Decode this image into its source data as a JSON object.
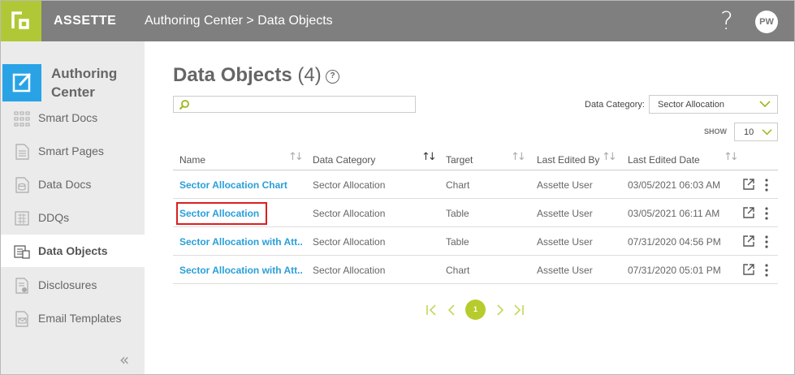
{
  "header": {
    "brand": "ASSETTE",
    "breadcrumb": "Authoring Center > Data Objects",
    "help": "?",
    "avatar": "PW"
  },
  "sidebar": {
    "title": "Authoring Center",
    "items": [
      {
        "label": "Smart Docs",
        "icon": "grid-dots-icon"
      },
      {
        "label": "Smart Pages",
        "icon": "page-icon"
      },
      {
        "label": "Data Docs",
        "icon": "data-doc-icon"
      },
      {
        "label": "DDQs",
        "icon": "ddq-icon"
      },
      {
        "label": "Data Objects",
        "icon": "data-objects-icon",
        "active": true
      },
      {
        "label": "Disclosures",
        "icon": "disclosure-icon"
      },
      {
        "label": "Email Templates",
        "icon": "email-template-icon"
      }
    ],
    "collapse": "«"
  },
  "main": {
    "title": "Data Objects",
    "count": "(4)",
    "title_help": "?",
    "search_placeholder": "",
    "category_label": "Data Category:",
    "category_value": "Sector Allocation",
    "show_label": "SHOW",
    "show_value": "10"
  },
  "table": {
    "columns": [
      "Name",
      "Data Category",
      "Target",
      "Last Edited By",
      "Last Edited Date"
    ],
    "rows": [
      {
        "name": "Sector Allocation Chart",
        "category": "Sector Allocation",
        "target": "Chart",
        "editor": "Assette User",
        "date": "03/05/2021 06:03 AM"
      },
      {
        "name": "Sector Allocation",
        "category": "Sector Allocation",
        "target": "Table",
        "editor": "Assette User",
        "date": "03/05/2021 06:11 AM"
      },
      {
        "name": "Sector Allocation with Att...",
        "category": "Sector Allocation",
        "target": "Table",
        "editor": "Assette User",
        "date": "07/31/2020 04:56 PM"
      },
      {
        "name": "Sector Allocation with Att...",
        "category": "Sector Allocation",
        "target": "Chart",
        "editor": "Assette User",
        "date": "07/31/2020 05:01 PM"
      }
    ]
  },
  "pagination": {
    "current": "1"
  },
  "colors": {
    "accent": "#b1c836",
    "link": "#2a9fd8",
    "header": "#7f7f7f",
    "sidebar_icon": "#29a3e6",
    "highlight": "#d92020"
  }
}
